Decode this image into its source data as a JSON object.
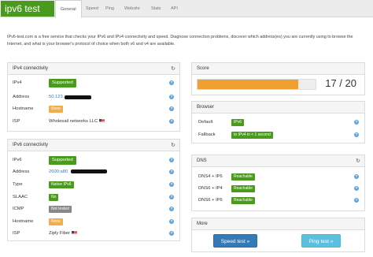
{
  "logo": "ipv6 test",
  "nav": {
    "tabs": [
      "General",
      "Speed",
      "Ping",
      "Website",
      "Stats",
      "API"
    ]
  },
  "intro": "IPv6-test.com is a free service that checks your IPv6 and IPv4 connectivity and speed. Diagnose connection problems, discover which address(es) you are currently using to browse the Internet, and what is your browser's protocol of choice when both v6 and v4 are available.",
  "ipv4": {
    "title": "IPv4 connectivity",
    "rows": [
      {
        "label": "IPv4",
        "value": "Supported"
      },
      {
        "label": "Address",
        "value": "50.123."
      },
      {
        "label": "Hostname",
        "value": "None"
      },
      {
        "label": "ISP",
        "value": "Wholesail networks LLC"
      }
    ]
  },
  "ipv6": {
    "title": "IPv6 connectivity",
    "rows": [
      {
        "label": "IPv6",
        "value": "Supported"
      },
      {
        "label": "Address",
        "value": "2600:a80"
      },
      {
        "label": "Type",
        "value": "Native IPv6"
      },
      {
        "label": "SLAAC",
        "value": "No"
      },
      {
        "label": "ICMP",
        "value": "Not tested"
      },
      {
        "label": "Hostname",
        "value": "None"
      },
      {
        "label": "ISP",
        "value": "Ziply Fiber"
      }
    ]
  },
  "score": {
    "title": "Score",
    "text": "17 / 20",
    "fraction": 0.85
  },
  "browser": {
    "title": "Browser",
    "rows": [
      {
        "label": "Default",
        "value": "IPv6"
      },
      {
        "label": "Fallback",
        "value": "to IPv4 in < 1 second"
      }
    ]
  },
  "dns": {
    "title": "DNS",
    "rows": [
      {
        "label": "DNS4 + IP6",
        "value": "Reachable"
      },
      {
        "label": "DNS6 + IP4",
        "value": "Reachable"
      },
      {
        "label": "DNS6 + IP6",
        "value": "Reachable"
      }
    ]
  },
  "more": {
    "title": "More",
    "speed_button": "Speed test »",
    "ping_button": "Ping test »"
  },
  "icons": {
    "refresh": "refresh-icon",
    "help": "help-icon",
    "flag": "us-flag-icon"
  },
  "colors": {
    "brand": "#4a9a1e",
    "accent": "#f0a030",
    "link": "#3a7bbf"
  }
}
